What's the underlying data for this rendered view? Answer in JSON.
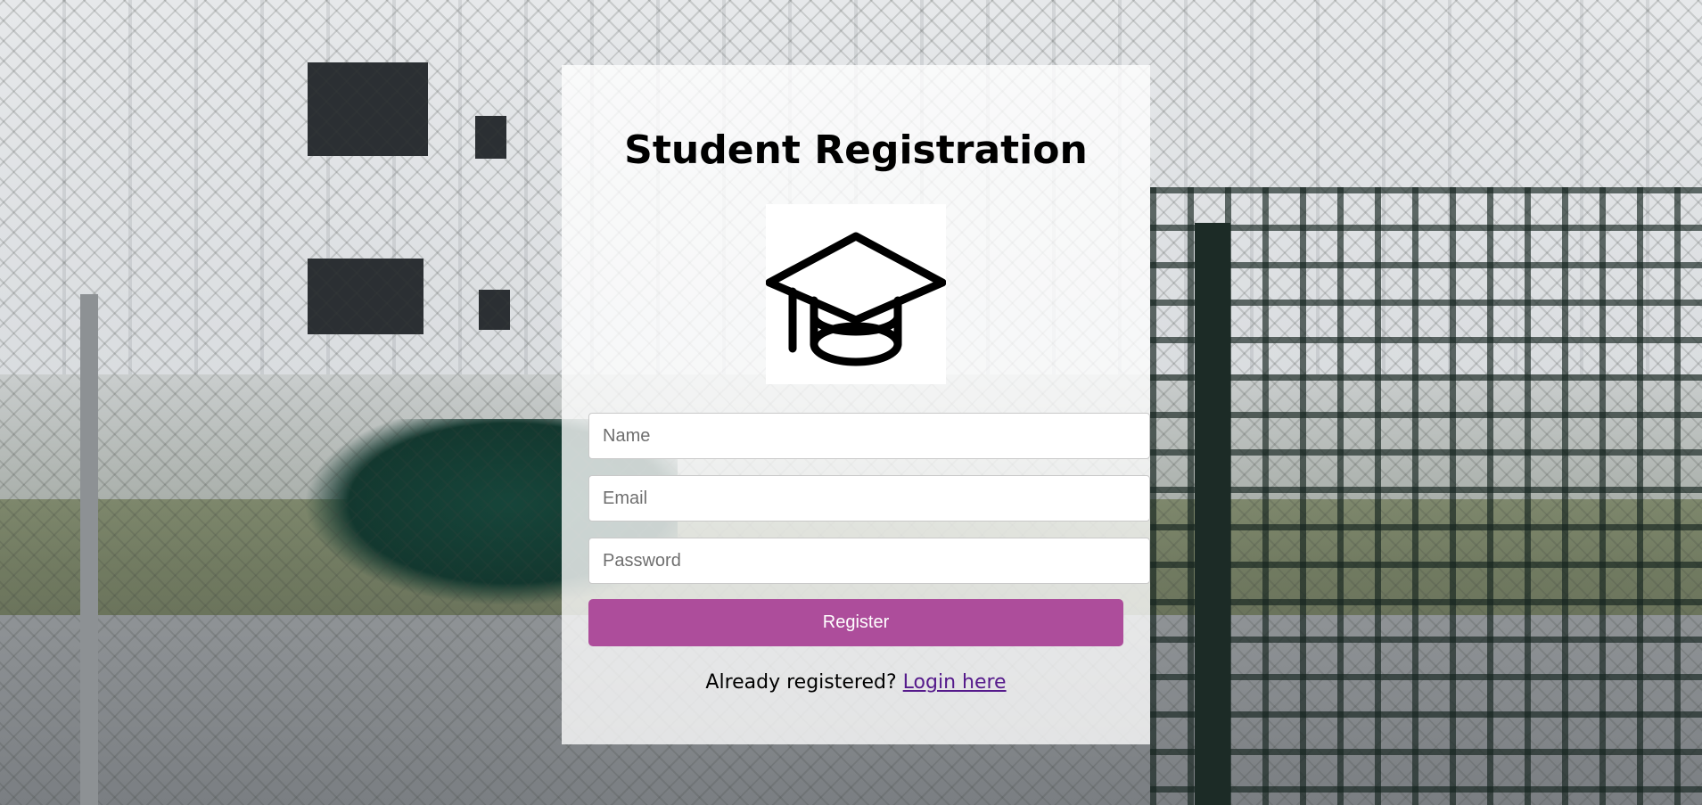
{
  "form": {
    "title": "Student Registration",
    "logo_icon": "graduation-cap-icon",
    "name_placeholder": "Name",
    "email_placeholder": "Email",
    "password_placeholder": "Password",
    "submit_label": "Register",
    "footer_text": "Already registered?",
    "login_link_label": "Login here"
  },
  "colors": {
    "button": "#ad4d9b",
    "link": "#551a8b",
    "panel": "rgba(255,255,255,0.78)"
  }
}
